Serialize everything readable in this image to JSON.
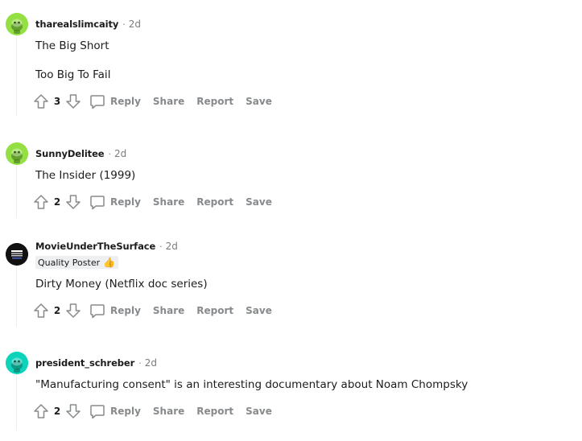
{
  "colors": {
    "snoo_green": "#94e044",
    "snoo_teal": "#0dd3bb",
    "meta_gray": "#7c7c7c",
    "action_gray": "#878a8c"
  },
  "actions": {
    "reply": "Reply",
    "share": "Share",
    "report": "Report",
    "save": "Save"
  },
  "comments": [
    {
      "username": "tharealslimcaity",
      "time": "2d",
      "score": "3",
      "avatar_icon": "snoo-green-avatar-icon",
      "lines": [
        "The Big Short",
        "Too Big To Fail"
      ]
    },
    {
      "username": "SunnyDelitee",
      "time": "2d",
      "score": "2",
      "avatar_icon": "snoo-green-avatar-icon",
      "lines": [
        "The Insider (1999)"
      ]
    },
    {
      "username": "MovieUnderTheSurface",
      "time": "2d",
      "score": "2",
      "avatar_icon": "movies-under-the-surface-logo",
      "avatar_text": "MOVIES UNDER THE SURFACE",
      "flair": "Quality Poster",
      "flair_emoji": "👍",
      "lines": [
        "Dirty Money (Netflix doc series)"
      ]
    },
    {
      "username": "president_schreber",
      "time": "2d",
      "score": "2",
      "avatar_icon": "snoo-teal-avatar-icon",
      "lines": [
        "\"Manufacturing consent\" is an interesting documentary about Noam Chompsky"
      ]
    }
  ]
}
